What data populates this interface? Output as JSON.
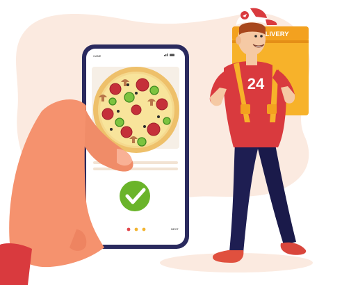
{
  "phone": {
    "status_left": "CANE",
    "next_label": "NEXT",
    "dots": [
      "#e2474c",
      "#f2b430",
      "#f2b430"
    ]
  },
  "courier": {
    "bag_label": "DELIVERY",
    "shirt_number": "24"
  },
  "icons": [
    "pizza-icon",
    "checkmark-icon",
    "signal-icon",
    "battery-icon",
    "cap-logo-icon"
  ],
  "colors": {
    "background_blob": "#fbeae0",
    "phone_frame": "#2a2a5e",
    "bag": "#f7b22a",
    "shirt": "#d93a3e",
    "pants": "#1e1e52",
    "check_green": "#6ab42a",
    "skin": "#f5926e"
  }
}
